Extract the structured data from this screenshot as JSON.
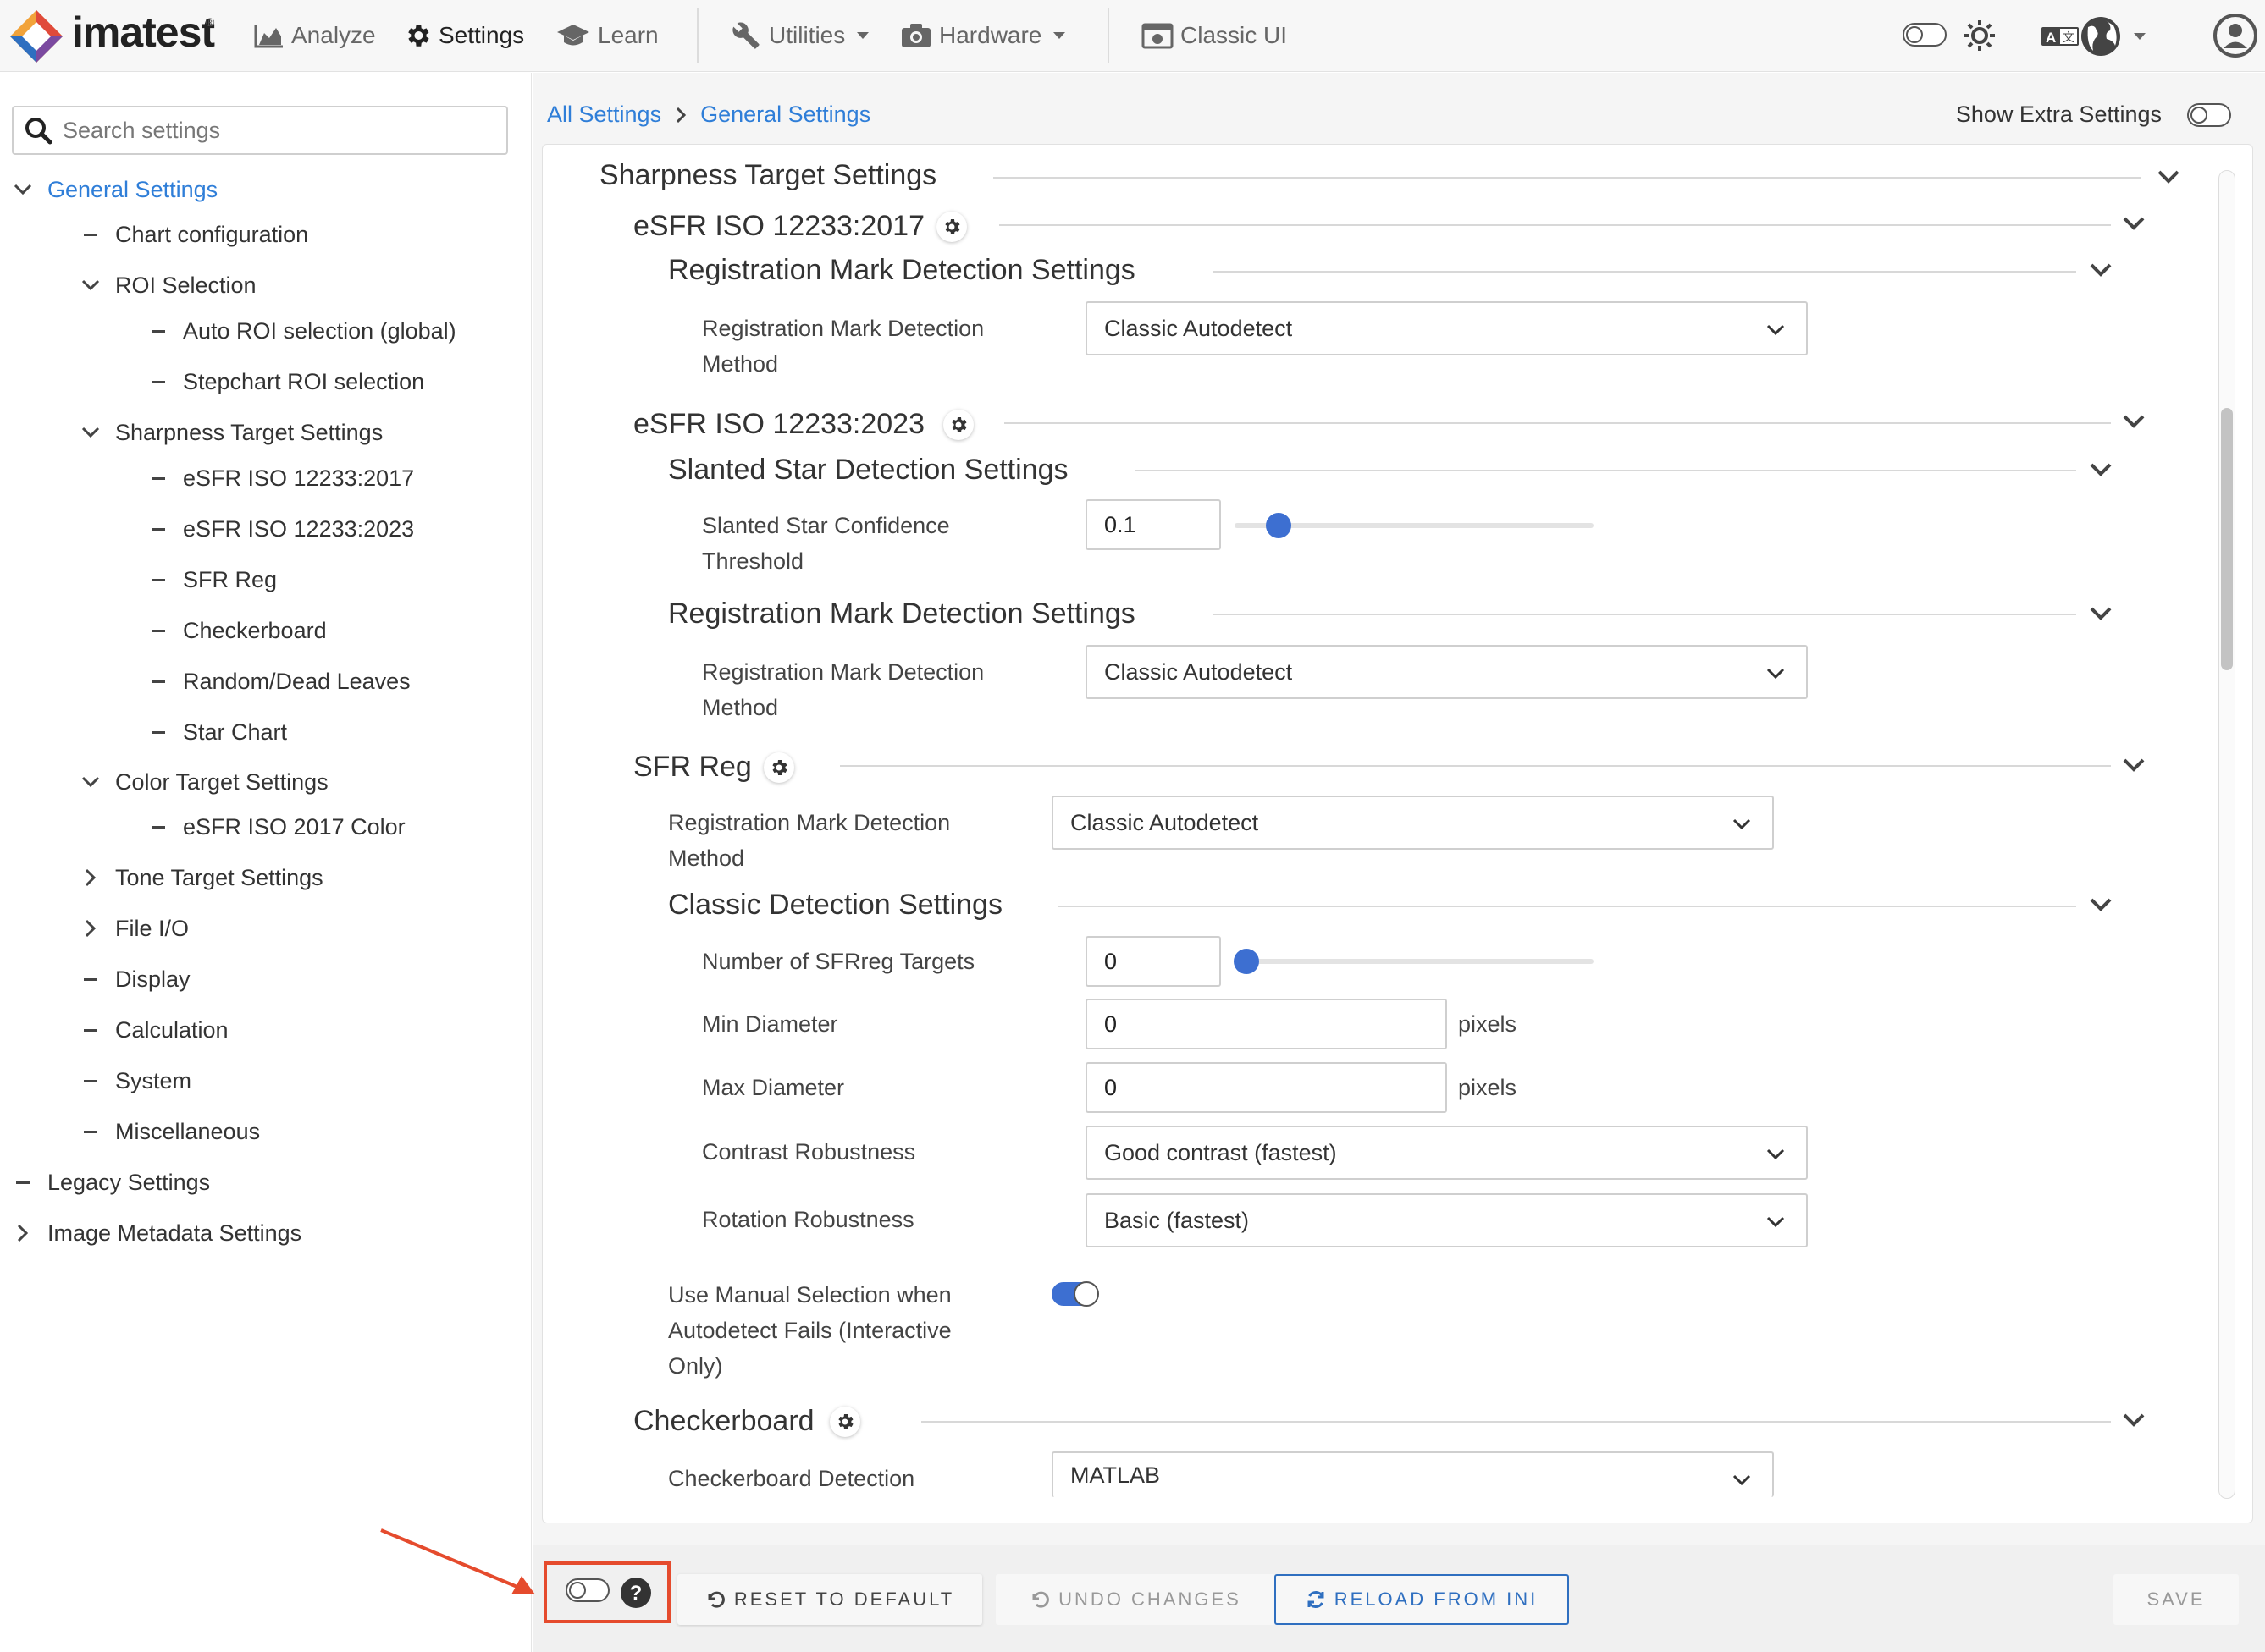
{
  "app": {
    "brand": "imatest",
    "reg_mark": "®"
  },
  "nav": {
    "analyze": "Analyze",
    "settings": "Settings",
    "learn": "Learn",
    "utilities": "Utilities",
    "hardware": "Hardware",
    "classic": "Classic UI"
  },
  "sidebar": {
    "search_placeholder": "Search settings",
    "items": {
      "general": "General Settings",
      "chart_config": "Chart configuration",
      "roi_selection": "ROI Selection",
      "auto_roi": "Auto ROI selection (global)",
      "stepchart_roi": "Stepchart ROI selection",
      "sharpness": "Sharpness Target Settings",
      "esfr2017": "eSFR ISO 12233:2017",
      "esfr2023": "eSFR ISO 12233:2023",
      "sfrreg": "SFR Reg",
      "checkerboard": "Checkerboard",
      "random": "Random/Dead Leaves",
      "star": "Star Chart",
      "color_target": "Color Target Settings",
      "esfr_color": "eSFR ISO 2017 Color",
      "tone_target": "Tone Target Settings",
      "file_io": "File I/O",
      "display": "Display",
      "calculation": "Calculation",
      "system": "System",
      "misc": "Miscellaneous",
      "legacy": "Legacy Settings",
      "metadata": "Image Metadata Settings"
    }
  },
  "breadcrumb": {
    "all": "All Settings",
    "current": "General Settings"
  },
  "show_extra": "Show Extra Settings",
  "content": {
    "sharpness_title": "Sharpness Target Settings",
    "esfr2017_title": "eSFR ISO 12233:2017",
    "reg_mark_detection_settings": "Registration Mark Detection Settings",
    "reg_mark_method_line1": "Registration Mark Detection",
    "reg_mark_method_line2": "Method",
    "classic_autodetect": "Classic Autodetect",
    "esfr2023_title": "eSFR ISO 12233:2023",
    "slanted_star_title": "Slanted Star Detection Settings",
    "slanted_conf_line1": "Slanted Star Confidence",
    "slanted_conf_line2": "Threshold",
    "slanted_conf_value": "0.1",
    "slanted_conf_level": 0.1,
    "sfrreg_title": "SFR Reg",
    "classic_detection_title": "Classic Detection Settings",
    "num_targets_label": "Number of SFRreg Targets",
    "num_targets_value": "0",
    "min_diameter_label": "Min Diameter",
    "min_diameter_value": "0",
    "max_diameter_label": "Max Diameter",
    "max_diameter_value": "0",
    "pixels": "pixels",
    "contrast_label": "Contrast Robustness",
    "contrast_value": "Good contrast (fastest)",
    "rotation_label": "Rotation Robustness",
    "rotation_value": "Basic (fastest)",
    "manual_line1": "Use Manual Selection when",
    "manual_line2": "Autodetect Fails (Interactive",
    "manual_line3": "Only)",
    "checkerboard_title": "Checkerboard",
    "checkerboard_detection_label": "Checkerboard Detection",
    "checkerboard_detection_value": "MATLAB"
  },
  "footer": {
    "reset": "RESET TO DEFAULT",
    "undo": "UNDO CHANGES",
    "reload": "RELOAD FROM INI",
    "save": "SAVE"
  },
  "colors": {
    "accent": "#2f7ed8",
    "toggle_on": "#3d6fd1",
    "annotation": "#e54b2d"
  }
}
